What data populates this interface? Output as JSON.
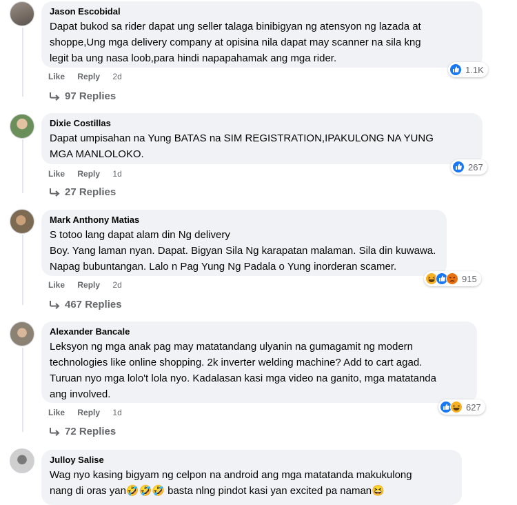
{
  "actions": {
    "like": "Like",
    "reply": "Reply"
  },
  "colors": {
    "like_blue": "#1877f2",
    "haha_yellow": "#f7b125",
    "angry_orange": "#e9710f",
    "bubble": "#f0f2f5"
  },
  "comments": [
    {
      "author": "Jason Escobidal",
      "lines": [
        "Dapat bukod sa rider dapat ung seller talaga binibigyan ng atensyon ng lazada at",
        "shoppe,Ung mga delivery company at opisina nila dapat may scanner na sila kng",
        "legit ba ung nasa loob,para hindi napapahamak ang mga rider."
      ],
      "time": "2d",
      "reactions": [
        "like-icon"
      ],
      "reaction_count": "1.1K",
      "replies": "97 Replies"
    },
    {
      "author": "Dixie Costillas",
      "lines": [
        "Dapat umpisahan na Yung BATAS na SIM REGISTRATION,IPAKULONG NA YUNG",
        "MGA MANLOLOKO."
      ],
      "time": "1d",
      "reactions": [
        "like-icon"
      ],
      "reaction_count": "267",
      "replies": "27 Replies"
    },
    {
      "author": "Mark Anthony Matias",
      "lines": [
        "S totoo lang dapat alam din Ng delivery",
        "Boy. Yang laman nyan. Dapat. Bigyan Sila Ng karapatan malaman. Sila din kuwawa.",
        "Napag bubuntangan. Lalo n Pag Yung Ng Padala o Yung inorderan scamer."
      ],
      "time": "2d",
      "reactions": [
        "haha-icon",
        "like-icon",
        "angry-icon"
      ],
      "reaction_count": "915",
      "replies": "467 Replies"
    },
    {
      "author": "Alexander Bancale",
      "lines": [
        "Leksyon ng mga anak pag may matatandang ulyanin na gumagamit ng modern",
        "technologies like online shopping. 2k inverter welding machine? Add to cart agad.",
        "Turuan nyo mga lolo't lola nyo. Kadalasan kasi mga video na ganito, mga matatanda",
        "ang involved."
      ],
      "time": "1d",
      "reactions": [
        "like-icon",
        "haha-icon"
      ],
      "reaction_count": "627",
      "replies": "72 Replies"
    },
    {
      "author": "Julloy Salise",
      "lines": [
        "Wag nyo kasing bigyam ng celpon na android ang mga matatanda makukulong",
        "nang di oras yan🤣🤣🤣 basta nlng pindot kasi yan excited pa naman😆"
      ],
      "time": "",
      "reactions": [],
      "reaction_count": "",
      "replies": ""
    }
  ]
}
